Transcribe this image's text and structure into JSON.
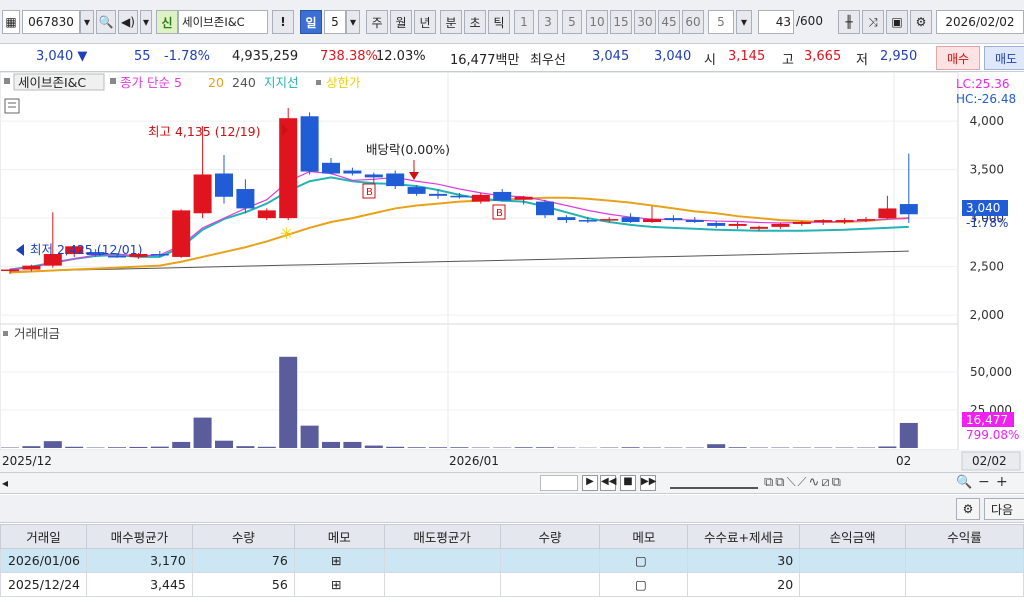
{
  "toolbar": {
    "code": "067830",
    "name": "세이브존I&C",
    "credit": "신",
    "periods": [
      "일",
      "5",
      "주",
      "월",
      "년",
      "분",
      "초",
      "틱"
    ],
    "intervals": [
      "1",
      "3",
      "5",
      "10",
      "15",
      "30",
      "45",
      "60"
    ],
    "interval_value": "5",
    "count": "43",
    "count_total": "/600",
    "date": "2026/02/02"
  },
  "quote": {
    "price": "3,040 ▼",
    "change": "55",
    "change_pct": "-1.78%",
    "volume": "4,935,259",
    "vol_ratio": "738.38%",
    "turnover": "12.03%",
    "amount": "16,477백만",
    "best_label": "최우선",
    "ask": "3,045",
    "bid": "3,040",
    "open_label": "시",
    "open": "3,145",
    "high_label": "고",
    "high": "3,665",
    "low_label": "저",
    "low": "2,950",
    "buy_btn": "매수",
    "sell_btn": "매도"
  },
  "legend": {
    "name": "세이브존I&C",
    "close": "종가 단순 5",
    "ma20": "20",
    "ma240": "240",
    "support": "지지선",
    "upper": "상한가"
  },
  "right_labels": {
    "lc": "LC:25.36",
    "hc": "HC:-26.48",
    "price": "3,040",
    "price_pct": "-1.78%",
    "vol": "16,477",
    "vol_pct": "799.08%"
  },
  "annotations": {
    "high": "최고 4,135 (12/19)",
    "low": "최저 2,425 (12/01)",
    "dividend": "배당락(0.00%)"
  },
  "volume_title": "거래대금",
  "x_axis": {
    "labels": [
      "2025/12",
      "2026/01",
      "02"
    ],
    "cursor": "02/02"
  },
  "table_tools": {
    "next": "다음"
  },
  "table": {
    "headers": [
      "거래일",
      "매수평균가",
      "수량",
      "메모",
      "매도평균가",
      "수량",
      "메모",
      "수수료+제세금",
      "손익금액",
      "수익률"
    ],
    "rows": [
      [
        "2026/01/06",
        "3,170",
        "76",
        "",
        "",
        "",
        "",
        "30",
        "",
        ""
      ],
      [
        "2025/12/24",
        "3,445",
        "56",
        "",
        "",
        "",
        "",
        "20",
        "",
        ""
      ]
    ]
  },
  "colors": {
    "up": "#e0141e",
    "down": "#1f5cd6",
    "ma5": "#e03adf",
    "ma20": "#e8a21a",
    "ma60": "#24b3b3",
    "ma240": "#555555",
    "volume": "#5a5c9c",
    "accent": "#f020f0"
  },
  "chart_data": {
    "type": "candlestick",
    "price_axis": {
      "ticks": [
        2000,
        2500,
        3000,
        3500,
        4000
      ],
      "ylim": [
        1950,
        4300
      ]
    },
    "volume_axis": {
      "ticks": [
        25000,
        50000
      ],
      "ylim": [
        0,
        75000
      ]
    },
    "candles": [
      {
        "o": 2460,
        "h": 2480,
        "l": 2425,
        "c": 2470
      },
      {
        "o": 2470,
        "h": 2520,
        "l": 2450,
        "c": 2510
      },
      {
        "o": 2510,
        "h": 3060,
        "l": 2490,
        "c": 2630
      },
      {
        "o": 2630,
        "h": 2720,
        "l": 2600,
        "c": 2710
      },
      {
        "o": 2650,
        "h": 2680,
        "l": 2600,
        "c": 2620
      },
      {
        "o": 2610,
        "h": 2640,
        "l": 2590,
        "c": 2600
      },
      {
        "o": 2600,
        "h": 2640,
        "l": 2580,
        "c": 2630
      },
      {
        "o": 2630,
        "h": 2660,
        "l": 2600,
        "c": 2620
      },
      {
        "o": 2600,
        "h": 3090,
        "l": 2590,
        "c": 3080
      },
      {
        "o": 3050,
        "h": 3950,
        "l": 3000,
        "c": 3450
      },
      {
        "o": 3460,
        "h": 3650,
        "l": 3150,
        "c": 3220
      },
      {
        "o": 3300,
        "h": 3400,
        "l": 3050,
        "c": 3100
      },
      {
        "o": 3000,
        "h": 3100,
        "l": 2980,
        "c": 3080
      },
      {
        "o": 3000,
        "h": 4135,
        "l": 2980,
        "c": 4030
      },
      {
        "o": 4050,
        "h": 4090,
        "l": 3450,
        "c": 3480
      },
      {
        "o": 3570,
        "h": 3620,
        "l": 3450,
        "c": 3460
      },
      {
        "o": 3490,
        "h": 3520,
        "l": 3440,
        "c": 3460
      },
      {
        "o": 3450,
        "h": 3470,
        "l": 3300,
        "c": 3420
      },
      {
        "o": 3460,
        "h": 3490,
        "l": 3300,
        "c": 3330
      },
      {
        "o": 3320,
        "h": 3340,
        "l": 3230,
        "c": 3250
      },
      {
        "o": 3250,
        "h": 3300,
        "l": 3200,
        "c": 3230
      },
      {
        "o": 3230,
        "h": 3260,
        "l": 3200,
        "c": 3220
      },
      {
        "o": 3170,
        "h": 3260,
        "l": 3150,
        "c": 3240
      },
      {
        "o": 3270,
        "h": 3300,
        "l": 3170,
        "c": 3180
      },
      {
        "o": 3190,
        "h": 3230,
        "l": 3140,
        "c": 3220
      },
      {
        "o": 3170,
        "h": 3190,
        "l": 3000,
        "c": 3030
      },
      {
        "o": 3010,
        "h": 3030,
        "l": 2950,
        "c": 2980
      },
      {
        "o": 2980,
        "h": 3010,
        "l": 2950,
        "c": 2970
      },
      {
        "o": 2980,
        "h": 3010,
        "l": 2960,
        "c": 2990
      },
      {
        "o": 3010,
        "h": 3050,
        "l": 2950,
        "c": 2960
      },
      {
        "o": 2960,
        "h": 3120,
        "l": 2950,
        "c": 2990
      },
      {
        "o": 3000,
        "h": 3030,
        "l": 2960,
        "c": 2980
      },
      {
        "o": 2980,
        "h": 3010,
        "l": 2950,
        "c": 2960
      },
      {
        "o": 2950,
        "h": 2970,
        "l": 2900,
        "c": 2920
      },
      {
        "o": 2920,
        "h": 2960,
        "l": 2890,
        "c": 2940
      },
      {
        "o": 2890,
        "h": 2920,
        "l": 2870,
        "c": 2910
      },
      {
        "o": 2910,
        "h": 2950,
        "l": 2890,
        "c": 2940
      },
      {
        "o": 2940,
        "h": 2970,
        "l": 2920,
        "c": 2960
      },
      {
        "o": 2960,
        "h": 2990,
        "l": 2930,
        "c": 2980
      },
      {
        "o": 2960,
        "h": 3000,
        "l": 2940,
        "c": 2980
      },
      {
        "o": 2980,
        "h": 3010,
        "l": 2960,
        "c": 2990
      },
      {
        "o": 3000,
        "h": 3230,
        "l": 2990,
        "c": 3100
      },
      {
        "o": 3145,
        "h": 3665,
        "l": 2950,
        "c": 3040
      }
    ],
    "volume": [
      300,
      1200,
      4500,
      800,
      300,
      500,
      700,
      900,
      4000,
      20000,
      4800,
      1200,
      800,
      60000,
      14700,
      4000,
      4000,
      1600,
      800,
      500,
      500,
      500,
      300,
      300,
      500,
      500,
      300,
      200,
      300,
      500,
      300,
      300,
      300,
      2500,
      500,
      300,
      300,
      300,
      300,
      300,
      300,
      1000,
      16477
    ],
    "ma5": [
      2470,
      2490,
      2540,
      2580,
      2620,
      2630,
      2610,
      2620,
      2720,
      2900,
      3000,
      3100,
      3190,
      3380,
      3480,
      3460,
      3390,
      3400,
      3420,
      3380,
      3350,
      3300,
      3260,
      3230,
      3220,
      3180,
      3130,
      3080,
      3040,
      3010,
      2990,
      2985,
      2980,
      2970,
      2965,
      2955,
      2950,
      2955,
      2960,
      2965,
      2975,
      2990,
      3000
    ],
    "ma20": [
      2440,
      2450,
      2460,
      2470,
      2480,
      2490,
      2500,
      2510,
      2550,
      2600,
      2650,
      2700,
      2760,
      2830,
      2900,
      2960,
      3000,
      3050,
      3100,
      3130,
      3150,
      3170,
      3180,
      3190,
      3200,
      3210,
      3210,
      3200,
      3180,
      3160,
      3130,
      3100,
      3070,
      3050,
      3020,
      3000,
      2980,
      2970,
      2960,
      2960,
      2970,
      2990,
      3000
    ],
    "ma60": [
      2470,
      2500,
      2540,
      2580,
      2610,
      2620,
      2600,
      2600,
      2700,
      2880,
      2990,
      3060,
      3150,
      3280,
      3380,
      3420,
      3380,
      3360,
      3350,
      3330,
      3290,
      3240,
      3200,
      3180,
      3170,
      3120,
      3060,
      3000,
      2960,
      2930,
      2910,
      2900,
      2890,
      2880,
      2875,
      2870,
      2870,
      2870,
      2875,
      2880,
      2890,
      2900,
      2910
    ],
    "ma240": [
      2450,
      2455,
      2460,
      2465,
      2470,
      2475,
      2480,
      2485,
      2490,
      2495,
      2500,
      2505,
      2510,
      2515,
      2520,
      2525,
      2530,
      2535,
      2540,
      2545,
      2550,
      2555,
      2560,
      2565,
      2570,
      2575,
      2580,
      2585,
      2590,
      2595,
      2600,
      2605,
      2610,
      2615,
      2620,
      2625,
      2630,
      2635,
      2640,
      2645,
      2650,
      2655,
      2660
    ]
  }
}
